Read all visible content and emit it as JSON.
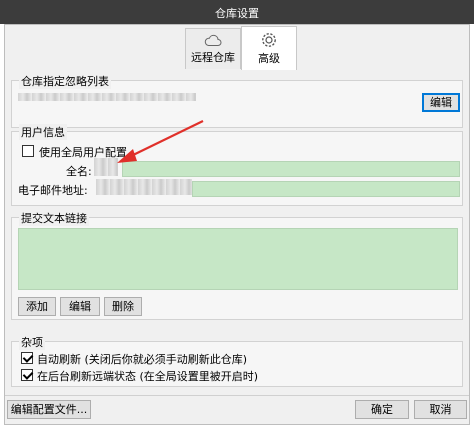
{
  "window": {
    "title": "仓库设置"
  },
  "tabs": [
    {
      "label": "远程仓库",
      "icon": "cloud-icon"
    },
    {
      "label": "高级",
      "icon": "gear-icon"
    }
  ],
  "ignore_list": {
    "title": "仓库指定忽略列表",
    "edit_label": "编辑"
  },
  "user_info": {
    "title": "用户信息",
    "use_global_label": "使用全局用户配置",
    "use_global_checked": false,
    "fullname_label": "全名:",
    "email_label": "电子邮件地址:"
  },
  "commit_links": {
    "title": "提交文本链接",
    "add_label": "添加",
    "edit_label": "编辑",
    "delete_label": "删除"
  },
  "misc": {
    "title": "杂项",
    "auto_refresh_label": "自动刷新 (关闭后你就必须手动刷新此仓库)",
    "auto_refresh_checked": true,
    "bg_refresh_label": "在后台刷新远端状态 (在全局设置里被开启时)",
    "bg_refresh_checked": true
  },
  "footer": {
    "edit_config_label": "编辑配置文件...",
    "ok_label": "确定",
    "cancel_label": "取消"
  },
  "colors": {
    "annotation_arrow": "#e0302a",
    "field_bg": "#c6e7c6"
  }
}
